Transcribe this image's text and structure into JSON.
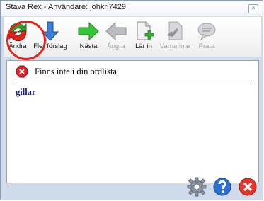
{
  "window": {
    "title": "Stava Rex - Användare: johkri7429"
  },
  "toolbar": {
    "items": [
      {
        "label": "Ändra",
        "enabled": true,
        "icon": "change-icon"
      },
      {
        "label": "Fler förslag",
        "enabled": true,
        "icon": "down-arrow-icon"
      },
      {
        "label": "Nästa",
        "enabled": true,
        "icon": "right-arrow-icon"
      },
      {
        "label": "Ångra",
        "enabled": false,
        "icon": "left-arrow-icon"
      },
      {
        "label": "Lär in",
        "enabled": true,
        "icon": "add-document-icon"
      },
      {
        "label": "Varna inte",
        "enabled": false,
        "icon": "no-warning-icon"
      },
      {
        "label": "Prata",
        "enabled": false,
        "icon": "speech-bubble-icon"
      }
    ]
  },
  "status": {
    "message": "Finns inte i din ordlista",
    "icon": "error-icon"
  },
  "word": {
    "text": "gillar"
  },
  "bottom_buttons": [
    {
      "icon": "settings-icon"
    },
    {
      "icon": "help-icon"
    },
    {
      "icon": "close-icon"
    }
  ],
  "colors": {
    "highlight": "#e8221a",
    "word": "#1a1a8c",
    "window_frame": "#cfdbea"
  }
}
